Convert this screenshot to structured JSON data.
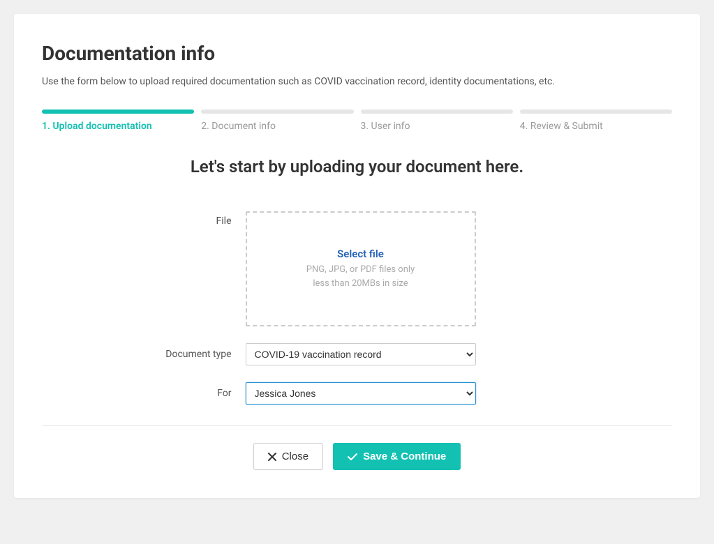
{
  "page": {
    "title": "Documentation info",
    "description": "Use the form below to upload required documentation such as COVID vaccination record, identity documentations, etc."
  },
  "stepper": {
    "steps": [
      {
        "label": "1. Upload documentation",
        "active": true
      },
      {
        "label": "2. Document info",
        "active": false
      },
      {
        "label": "3. User info",
        "active": false
      },
      {
        "label": "4. Review & Submit",
        "active": false
      }
    ]
  },
  "section": {
    "heading": "Let's start by uploading your document here."
  },
  "form": {
    "file": {
      "label": "File",
      "cta": "Select file",
      "hint_line1": "PNG, JPG, or PDF files only",
      "hint_line2": "less than 20MBs in size"
    },
    "document_type": {
      "label": "Document type",
      "value": "COVID-19 vaccination record"
    },
    "for": {
      "label": "For",
      "value": "Jessica Jones"
    }
  },
  "actions": {
    "close": "Close",
    "save_continue": "Save & Continue"
  }
}
